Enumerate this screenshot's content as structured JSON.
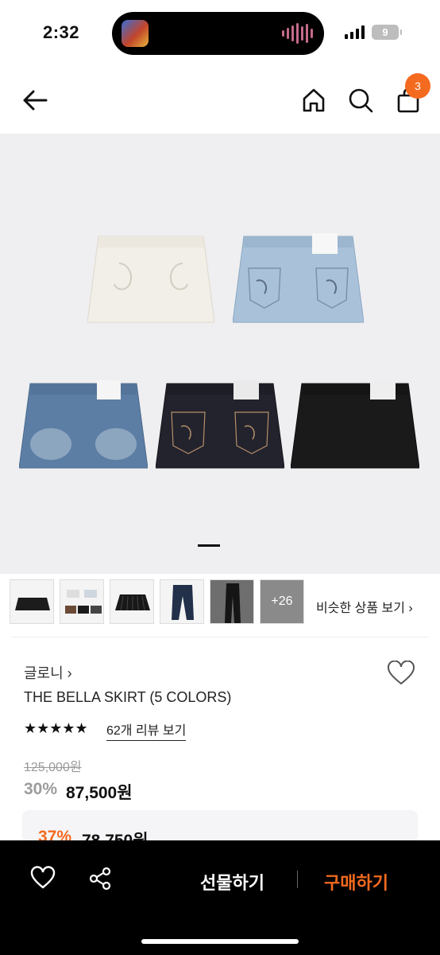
{
  "status_bar": {
    "time": "2:32",
    "battery": "9"
  },
  "header": {
    "cart_count": "3"
  },
  "hero": {
    "page_index": 1
  },
  "thumbnails": {
    "more_count": "+26",
    "similar_label": "비슷한 상품 보기 ›"
  },
  "product": {
    "brand": "글로니 ›",
    "title": "THE BELLA SKIRT (5 COLORS)",
    "stars": "★★★★★",
    "review_link": "62개 리뷰 보기",
    "original_price": "125,000원",
    "discount_rate": "30%",
    "sale_price": "87,500원",
    "coupon_rate": "37%",
    "coupon_price": "78,750원"
  },
  "bottom_bar": {
    "gift_label": "선물하기",
    "buy_label": "구매하기"
  },
  "colors": {
    "accent": "#f46a1f",
    "bar": "#000000",
    "hero_bg": "#efeff1"
  }
}
